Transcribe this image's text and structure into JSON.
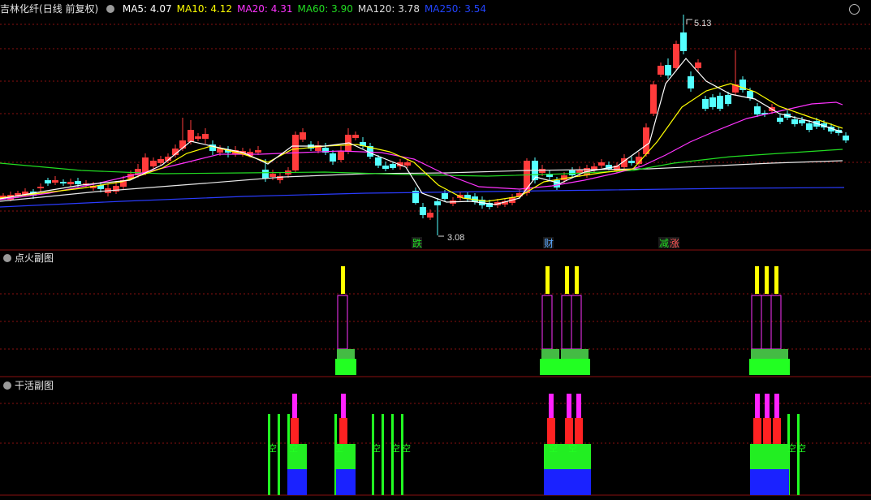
{
  "main": {
    "stock_name": "吉林化纤",
    "period": "(日线 前复权)",
    "ma": [
      {
        "label": "MA5: 4.07",
        "color": "#ffffff"
      },
      {
        "label": "MA10: 4.12",
        "color": "#ffff00"
      },
      {
        "label": "MA20: 4.31",
        "color": "#ff33ff"
      },
      {
        "label": "MA60: 3.90",
        "color": "#22dd22"
      },
      {
        "label": "MA120: 3.78",
        "color": "#dddddd"
      },
      {
        "label": "MA250: 3.54",
        "color": "#2244ff"
      }
    ],
    "high_label": "5.13",
    "low_label": "3.08",
    "tags": [
      {
        "text": "跌",
        "color": "#22dd22"
      },
      {
        "text": "财",
        "color": "#5aa8ff"
      },
      {
        "text": "减",
        "color": "#22dd22"
      },
      {
        "text": "涨",
        "color": "#ff5555"
      }
    ]
  },
  "sub1": {
    "title": "点火副图"
  },
  "sub2": {
    "title": "干活副图",
    "mark": "空"
  },
  "colors": {
    "up": "#ff3b3b",
    "down": "#54ffff",
    "grid": "#8a1010"
  }
}
